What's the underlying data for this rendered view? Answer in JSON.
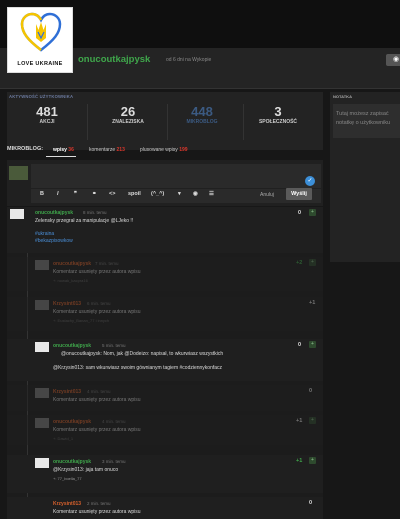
{
  "header": {
    "logo_text": "LOVE UKRAINE",
    "username": "onucoutkajpysk",
    "since": "od 6 dni na Wykopie"
  },
  "stats": {
    "heading": "AKTYWNOŚĆ UŻYTKOWNIKA",
    "items": [
      {
        "value": "481",
        "label": "AKCJI"
      },
      {
        "value": "26",
        "label": "ZNALEZISKA"
      },
      {
        "value": "448",
        "label": "MIKROBLOG"
      },
      {
        "value": "3",
        "label": "SPOŁECZNOŚĆ"
      }
    ]
  },
  "notes": {
    "heading": "NOTATKA",
    "placeholder": "Tutaj możesz zapisać notatkę o użytkowniku"
  },
  "tabs": {
    "label": "MIKROBLOG:",
    "items": [
      {
        "label": "wpisy",
        "count": "36"
      },
      {
        "label": "komentarze",
        "count": "213"
      },
      {
        "label": "plusowane wpisy",
        "count": "199"
      }
    ]
  },
  "composer": {
    "toolbar": [
      "B",
      "I",
      "❞",
      "⚭",
      "<>",
      "spoil",
      "(^_^)",
      "▾",
      "◉",
      "☰"
    ],
    "cancel_label": "Anuluj",
    "send_label": "Wyślij"
  },
  "feed": [
    {
      "name": "onucoutkajpysk",
      "time": "8 min. temu",
      "score": "0",
      "text": "Zelensky przegrał za manipulacje @LJeko !!",
      "tags": [
        "#ukraina",
        "#bekazpisowkow"
      ]
    },
    {
      "name": "onucoutkajpysk",
      "time": "7 min. temu",
      "score": "+2",
      "text": "Komentarz usunięty przez autora wpisu",
      "sub": "+: nowak_kacpra16"
    },
    {
      "name": "Krzysint013",
      "time": "6 min. temu",
      "score": "+1",
      "text": "Komentarz usunięty przez autora wpisu",
      "sub": "+: Eustachy_Banan_77 i innych"
    },
    {
      "name": "onucoutkajpysk",
      "time": "5 min. temu",
      "score": "0",
      "text_a": "@onucoutkajpysk: Nom, jak @Dodeizo: napisał, to wkurwiasz wszystkich",
      "text_b": "@Krzysin013: sam wkurwiasz swoim gównianym tagiem #codziennykonfacz"
    },
    {
      "name": "Krzysint013",
      "time": "4 min. temu",
      "score": "0",
      "text": "Komentarz usunięty przez autora wpisu"
    },
    {
      "name": "onucoutkajpysk",
      "time": "4 min. temu",
      "score": "+1",
      "text": "Komentarz usunięty przez autora wpisu",
      "sub": "+: Dawid_1"
    },
    {
      "name": "onucoutkajpysk",
      "time": "3 min. temu",
      "score": "+1",
      "text": "@Krzysin013: jaja tam onuco",
      "sub": "+: 77_boella_77"
    },
    {
      "name": "Krzysint013",
      "time": "2 min. temu",
      "score": "0",
      "text": "Komentarz usunięty przez autora wpisu"
    }
  ]
}
